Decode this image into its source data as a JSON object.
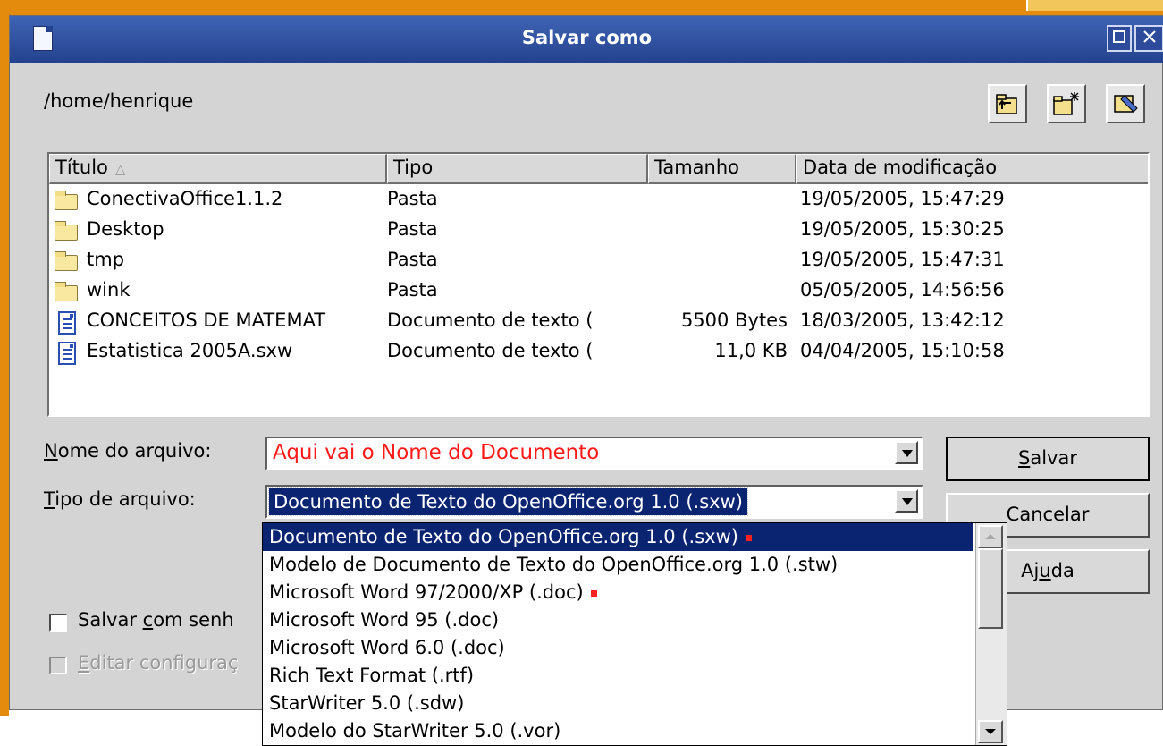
{
  "window": {
    "title": "Salvar como"
  },
  "path": "/home/henrique",
  "toolbar": {
    "up_folder_icon": "up-folder-icon",
    "new_folder_icon": "new-folder-icon",
    "default_dir_icon": "default-directory-icon"
  },
  "file_list": {
    "columns": [
      "Título",
      "Tipo",
      "Tamanho",
      "Data de modificação"
    ],
    "rows": [
      {
        "icon": "folder",
        "title": "ConectivaOffice1.1.2",
        "type": "Pasta",
        "size": "",
        "date": "19/05/2005, 15:47:29"
      },
      {
        "icon": "folder",
        "title": "Desktop",
        "type": "Pasta",
        "size": "",
        "date": "19/05/2005, 15:30:25"
      },
      {
        "icon": "folder",
        "title": "tmp",
        "type": "Pasta",
        "size": "",
        "date": "19/05/2005, 15:47:31"
      },
      {
        "icon": "folder",
        "title": "wink",
        "type": "Pasta",
        "size": "",
        "date": "05/05/2005, 14:56:56"
      },
      {
        "icon": "document",
        "title": "CONCEITOS DE MATEMAT",
        "type": "Documento de texto (",
        "size": "5500 Bytes",
        "date": "18/03/2005, 13:42:12"
      },
      {
        "icon": "document",
        "title": "Estatistica 2005A.sxw",
        "type": "Documento de texto (",
        "size": "11,0 KB",
        "date": "04/04/2005, 15:10:58"
      }
    ]
  },
  "filename": {
    "label_mnemonic": "N",
    "label_rest": "ome do arquivo:",
    "value": "Aqui vai o Nome do Documento",
    "value_color": "#ff1a1a"
  },
  "filetype": {
    "label_mnemonic": "T",
    "label_rest": "ipo de arquivo:",
    "value": "Documento de Texto do OpenOffice.org 1.0 (.sxw)",
    "options": [
      {
        "label": "Documento de Texto do OpenOffice.org 1.0 (.sxw)",
        "marked": true
      },
      {
        "label": "Modelo de Documento de Texto do OpenOffice.org 1.0 (.stw)",
        "marked": false
      },
      {
        "label": "Microsoft Word 97/2000/XP (.doc)",
        "marked": true
      },
      {
        "label": "Microsoft Word 95 (.doc)",
        "marked": false
      },
      {
        "label": "Microsoft Word 6.0 (.doc)",
        "marked": false
      },
      {
        "label": "Rich Text Format (.rtf)",
        "marked": false
      },
      {
        "label": "StarWriter 5.0 (.sdw)",
        "marked": false
      },
      {
        "label": "Modelo do StarWriter 5.0 (.vor)",
        "marked": false
      }
    ]
  },
  "buttons": {
    "save_mnemonic": "S",
    "save_rest": "alvar",
    "cancel_pre": "C",
    "cancel_rest": "ancelar",
    "help_pre": "Aj",
    "help_mnemonic": "u",
    "help_rest": "da"
  },
  "checkboxes": {
    "password_pre": "Salvar ",
    "password_mnemonic": "c",
    "password_rest": "om senh",
    "filter_mnemonic": "E",
    "filter_rest": "ditar configuraç"
  },
  "colors": {
    "title_bar": "#24428e",
    "selection": "#0a2471",
    "accent_orange": "#e48a0c",
    "marker_red": "#ff2020"
  }
}
